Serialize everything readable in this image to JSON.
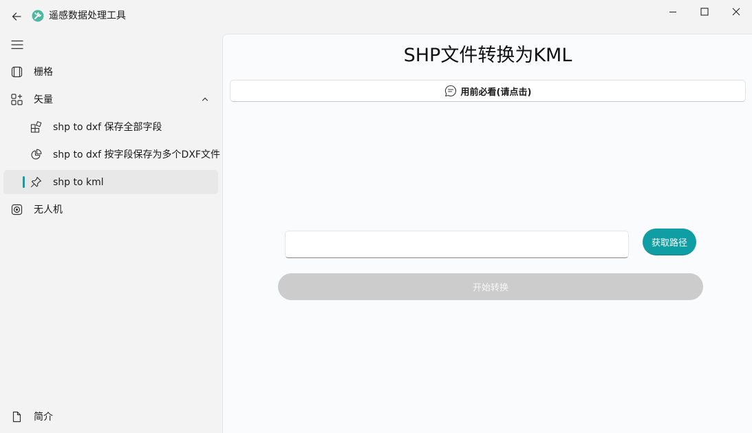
{
  "window": {
    "title": "遥感数据处理工具"
  },
  "sidebar": {
    "items": [
      {
        "label": "栅格",
        "icon": "film-icon"
      },
      {
        "label": "矢量",
        "icon": "grid-apps-icon",
        "expanded": true,
        "children": [
          {
            "label": "shp to dxf 保存全部字段",
            "icon": "puzzle-icon"
          },
          {
            "label": "shp to dxf 按字段保存为多个DXF文件",
            "icon": "pie-chart-icon"
          },
          {
            "label": "shp to kml",
            "icon": "pin-icon",
            "selected": true
          }
        ]
      },
      {
        "label": "无人机",
        "icon": "target-icon"
      }
    ],
    "footer": {
      "label": "简介",
      "icon": "document-icon"
    }
  },
  "main": {
    "title": "SHP文件转换为KML",
    "notice_button": "用前必看(请点击)",
    "path_input": {
      "value": "",
      "placeholder": ""
    },
    "get_path_button": "获取路径",
    "start_button": "开始转换",
    "start_button_enabled": false
  },
  "colors": {
    "accent": "#0f9ea4",
    "disabled": "#cccccc",
    "background": "#f3f3f3",
    "panel": "#f9fbfd"
  }
}
